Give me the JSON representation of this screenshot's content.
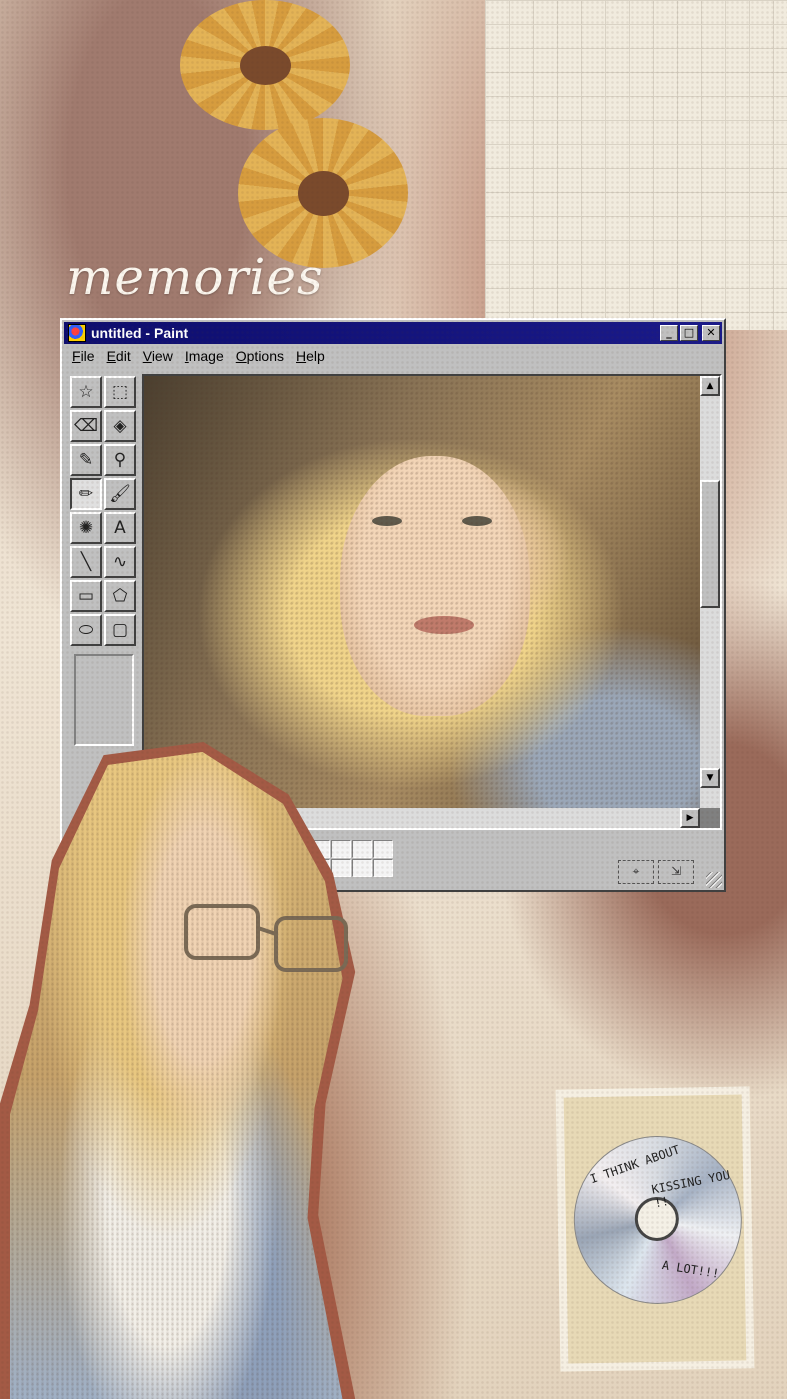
{
  "overlay_text": "memories",
  "window": {
    "title": "untitled - Paint",
    "buttons": {
      "minimize": "_",
      "maximize": "□",
      "close": "✕"
    },
    "menu": [
      "File",
      "Edit",
      "View",
      "Image",
      "Options",
      "Help"
    ]
  },
  "toolbox": {
    "tools": [
      {
        "name": "free-select-icon",
        "glyph": "☆"
      },
      {
        "name": "rect-select-icon",
        "glyph": "⬚"
      },
      {
        "name": "eraser-icon",
        "glyph": "⌫"
      },
      {
        "name": "fill-bucket-icon",
        "glyph": "◈"
      },
      {
        "name": "color-picker-icon",
        "glyph": "✎"
      },
      {
        "name": "magnifier-icon",
        "glyph": "⚲"
      },
      {
        "name": "pencil-icon",
        "glyph": "✏"
      },
      {
        "name": "brush-icon",
        "glyph": "🖌"
      },
      {
        "name": "airbrush-icon",
        "glyph": "✺"
      },
      {
        "name": "text-icon",
        "glyph": "A"
      },
      {
        "name": "line-icon",
        "glyph": "╲"
      },
      {
        "name": "curve-icon",
        "glyph": "∿"
      },
      {
        "name": "rectangle-icon",
        "glyph": "▭"
      },
      {
        "name": "polygon-icon",
        "glyph": "⬠"
      },
      {
        "name": "ellipse-icon",
        "glyph": "⬭"
      },
      {
        "name": "rounded-rect-icon",
        "glyph": "▢"
      }
    ],
    "active_tool": "pencil-icon"
  },
  "palette": {
    "foreground": "#000000",
    "swatch_count": 28
  },
  "cd_text": {
    "line1": "I THINK ABOUT",
    "line2": "KISSING YOU !!",
    "line3": "A LOT!!!"
  },
  "colors": {
    "titlebar": "#0d0d6e",
    "window": "#c0c0c0",
    "cutout_border": "#a35a45"
  }
}
